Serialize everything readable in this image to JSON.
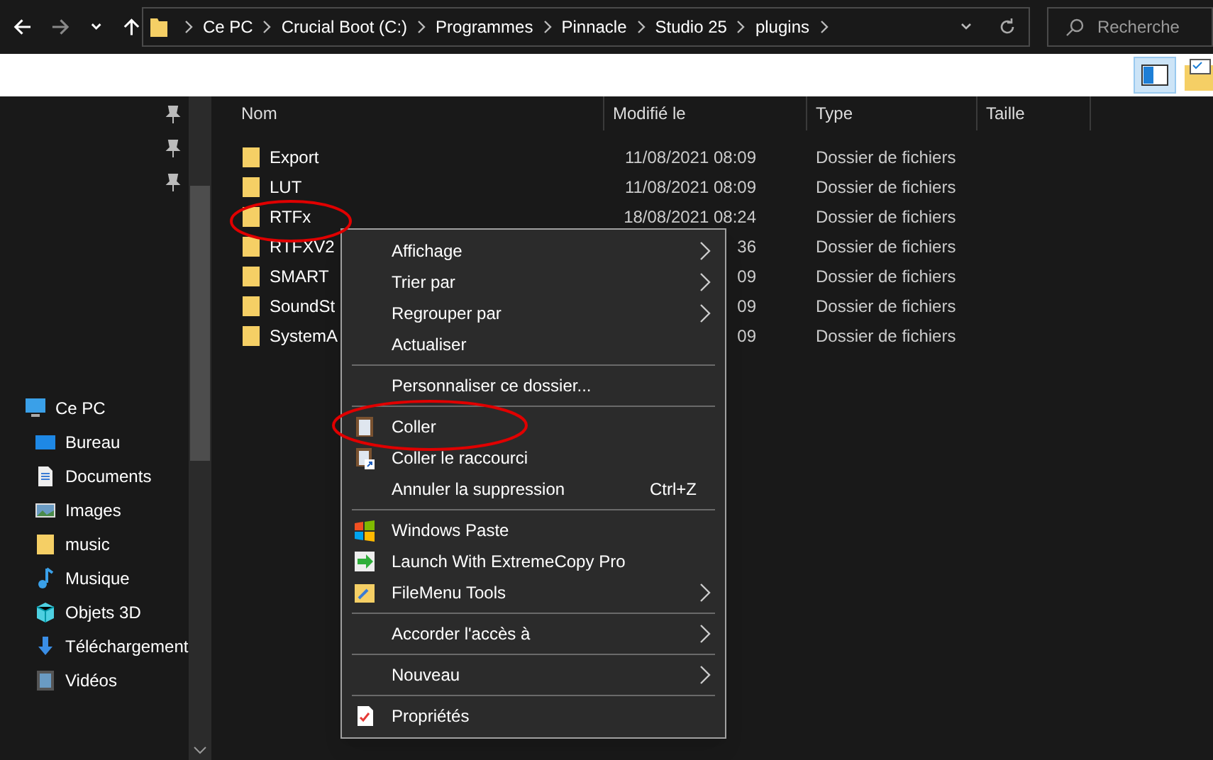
{
  "address_bar": {
    "crumbs": [
      "Ce PC",
      "Crucial Boot (C:)",
      "Programmes",
      "Pinnacle",
      "Studio 25",
      "plugins"
    ]
  },
  "search": {
    "placeholder": "Recherche"
  },
  "sidebar": {
    "items": [
      {
        "label": "Ce PC",
        "kind": "pc",
        "children": [
          {
            "label": "Bureau",
            "kind": "desktop"
          },
          {
            "label": "Documents",
            "kind": "documents"
          },
          {
            "label": "Images",
            "kind": "pictures"
          },
          {
            "label": "music",
            "kind": "folder"
          },
          {
            "label": "Musique",
            "kind": "music"
          },
          {
            "label": "Objets 3D",
            "kind": "objects"
          },
          {
            "label": "Téléchargement",
            "kind": "downloads"
          },
          {
            "label": "Vidéos",
            "kind": "videos"
          }
        ]
      }
    ]
  },
  "file_list": {
    "columns": [
      "Nom",
      "Modifié le",
      "Type",
      "Taille"
    ],
    "rows": [
      {
        "name": "Export",
        "modified": "11/08/2021 08:09",
        "type": "Dossier de fichiers"
      },
      {
        "name": "LUT",
        "modified": "11/08/2021 08:09",
        "type": "Dossier de fichiers"
      },
      {
        "name": "RTFx",
        "modified": "18/08/2021 08:24",
        "type": "Dossier de fichiers"
      },
      {
        "name": "RTFXV2",
        "modified": "36",
        "type": "Dossier de fichiers"
      },
      {
        "name": "SMART",
        "modified": "09",
        "type": "Dossier de fichiers"
      },
      {
        "name": "SoundSt",
        "modified": "09",
        "type": "Dossier de fichiers"
      },
      {
        "name": "SystemA",
        "modified": "09",
        "type": "Dossier de fichiers"
      }
    ]
  },
  "context_menu": {
    "groups": [
      [
        {
          "label": "Affichage",
          "submenu": true
        },
        {
          "label": "Trier par",
          "submenu": true
        },
        {
          "label": "Regrouper par",
          "submenu": true
        },
        {
          "label": "Actualiser",
          "submenu": false
        }
      ],
      [
        {
          "label": "Personnaliser ce dossier...",
          "submenu": false
        }
      ],
      [
        {
          "label": "Coller",
          "submenu": false,
          "kind": "clipboard"
        },
        {
          "label": "Coller le raccourci",
          "submenu": false,
          "kind": "shortcut"
        },
        {
          "label": "Annuler la suppression",
          "shortcut": "Ctrl+Z",
          "submenu": false
        }
      ],
      [
        {
          "label": "Windows Paste",
          "submenu": false,
          "kind": "windows"
        },
        {
          "label": "Launch With ExtremeCopy Pro",
          "submenu": false,
          "kind": "copy"
        },
        {
          "label": "FileMenu Tools",
          "submenu": true,
          "kind": "tools"
        }
      ],
      [
        {
          "label": "Accorder l'accès à",
          "submenu": true
        }
      ],
      [
        {
          "label": "Nouveau",
          "submenu": true
        }
      ],
      [
        {
          "label": "Propriétés",
          "submenu": false,
          "kind": "properties"
        }
      ]
    ]
  }
}
